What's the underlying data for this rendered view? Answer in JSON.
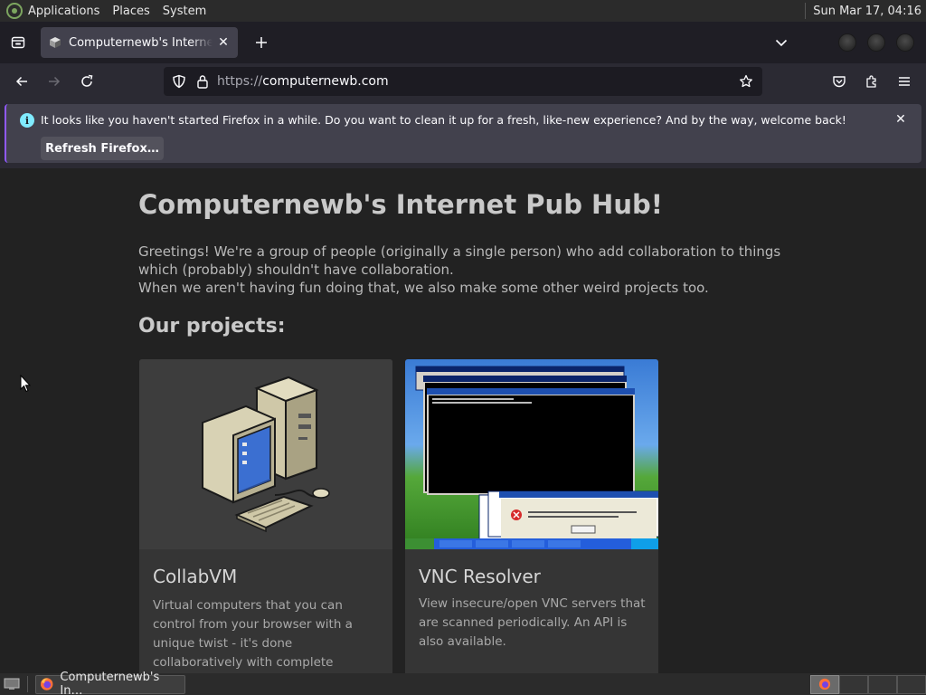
{
  "top_panel": {
    "menus": [
      "Applications",
      "Places",
      "System"
    ],
    "clock": "Sun Mar 17, 04:16"
  },
  "browser": {
    "tab": {
      "title": "Computernewb's Internet Pub Hub!"
    },
    "url": {
      "protocol": "https://",
      "host": "computernewb.com"
    },
    "notification": {
      "message": "It looks like you haven't started Firefox in a while. Do you want to clean it up for a fresh, like-new experience? And by the way, welcome back!",
      "button_label": "Refresh Firefox…"
    }
  },
  "page": {
    "title": "Computernewb's Internet Pub Hub!",
    "intro_line1": "Greetings! We're a group of people (originally a single person) who add collaboration to things which (probably) shouldn't have collaboration.",
    "intro_line2": "When we aren't having fun doing that, we also make some other weird projects too.",
    "projects_heading": "Our projects:",
    "projects": [
      {
        "title": "CollabVM",
        "description": "Virtual computers that you can control from your browser with a unique twist - it's done collaboratively with complete strangers."
      },
      {
        "title": "VNC Resolver",
        "description": "View insecure/open VNC servers that are scanned periodically. An API is also available."
      }
    ]
  },
  "taskbar": {
    "task_title": "Computernewb's In…"
  },
  "colors": {
    "accent": "#9059ff",
    "info": "#80ebff",
    "page_bg": "#222222"
  }
}
